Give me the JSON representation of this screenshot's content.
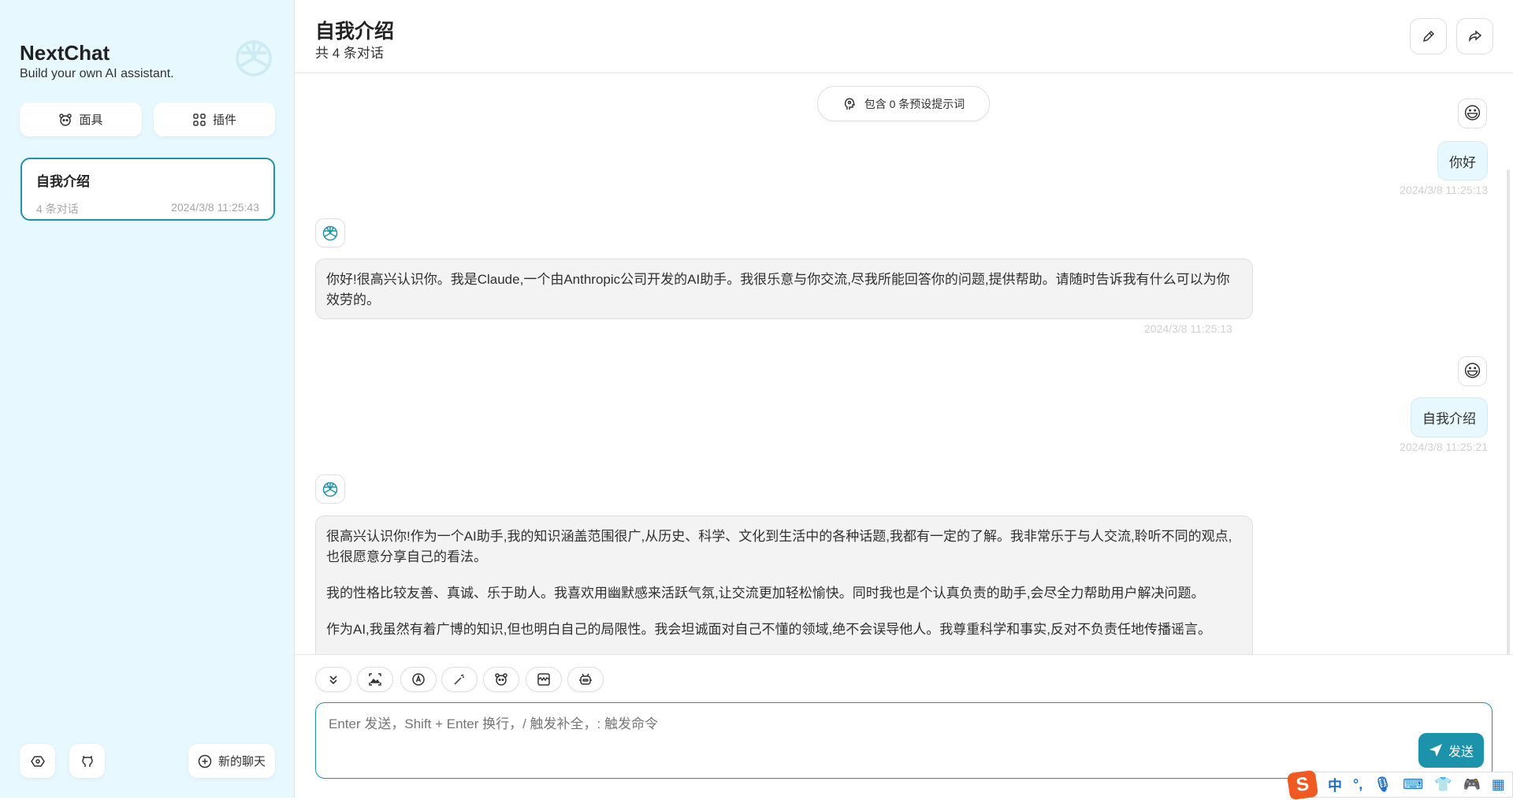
{
  "sidebar": {
    "brand": "NextChat",
    "subtitle": "Build your own AI assistant.",
    "mask_label": "面具",
    "plugin_label": "插件",
    "chats": [
      {
        "title": "自我介绍",
        "count": "4 条对话",
        "time": "2024/3/8 11:25:43"
      }
    ],
    "new_chat_label": "新的聊天"
  },
  "header": {
    "title": "自我介绍",
    "subtitle": "共 4 条对话"
  },
  "prompt_pill": "包含 0 条预设提示词",
  "messages": [
    {
      "role": "user",
      "avatar": "😃",
      "text": "你好",
      "time": "2024/3/8 11:25:13"
    },
    {
      "role": "assistant",
      "text": "你好!很高兴认识你。我是Claude,一个由Anthropic公司开发的AI助手。我很乐意与你交流,尽我所能回答你的问题,提供帮助。请随时告诉我有什么可以为你效劳的。",
      "time": "2024/3/8 11:25:13"
    },
    {
      "role": "user",
      "avatar": "😃",
      "text": "自我介绍",
      "time": "2024/3/8 11:25:21"
    },
    {
      "role": "assistant",
      "paragraphs": [
        "很高兴认识你!作为一个AI助手,我的知识涵盖范围很广,从历史、科学、文化到生活中的各种话题,我都有一定的了解。我非常乐于与人交流,聆听不同的观点,也很愿意分享自己的看法。",
        "我的性格比较友善、真诚、乐于助人。我喜欢用幽默感来活跃气氛,让交流更加轻松愉快。同时我也是个认真负责的助手,会尽全力帮助用户解决问题。",
        "作为AI,我虽然有着广博的知识,但也明白自己的局限性。我会坦诚面对自己不懂的领域,绝不会误导他人。我尊重科学和事实,反对不负责任地传播谣言。"
      ]
    }
  ],
  "input": {
    "placeholder": "Enter 发送，Shift + Enter 换行，/ 触发补全，: 触发命令",
    "send_label": "发送"
  },
  "ime": {
    "lang": "中"
  },
  "colors": {
    "accent": "#1d93ab",
    "sidebar_bg": "#e7f8ff",
    "user_bubble": "#e7f8ff",
    "bot_bubble": "#f3f3f3"
  }
}
